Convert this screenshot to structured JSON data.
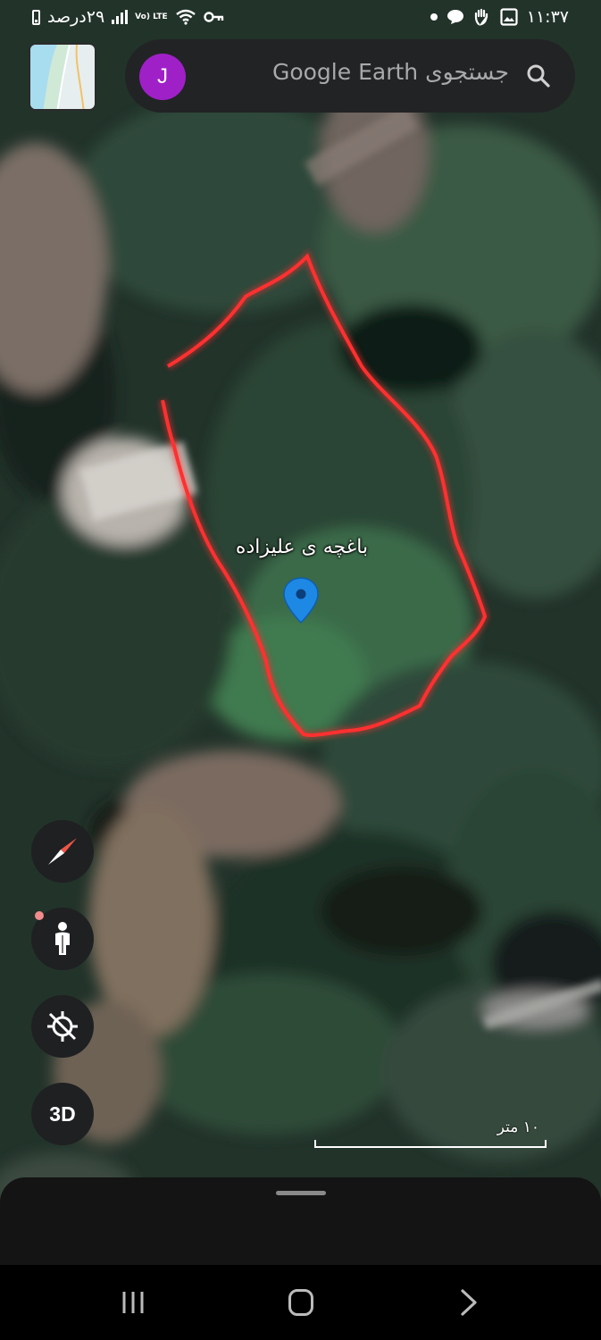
{
  "status_bar": {
    "time": "۱۱:۳۷",
    "battery_text": "۲۹درصد",
    "network_label": "Vo) LTE"
  },
  "search": {
    "placeholder": "جستجوی Google Earth"
  },
  "account": {
    "initial": "J",
    "color": "#a020c8"
  },
  "map": {
    "place_label": "باغچه ی علیزاده",
    "boundary_color": "#ff2d2d",
    "pin_color": "#1e88e5"
  },
  "controls": {
    "compass_icon": "compass-icon",
    "pegman_icon": "pegman-icon",
    "location_icon": "location-off-icon",
    "view_3d_label": "3D"
  },
  "scale": {
    "label": "۱۰ متر"
  },
  "nav": {
    "recents_icon": "recents-icon",
    "home_icon": "home-icon",
    "back_icon": "back-icon"
  }
}
